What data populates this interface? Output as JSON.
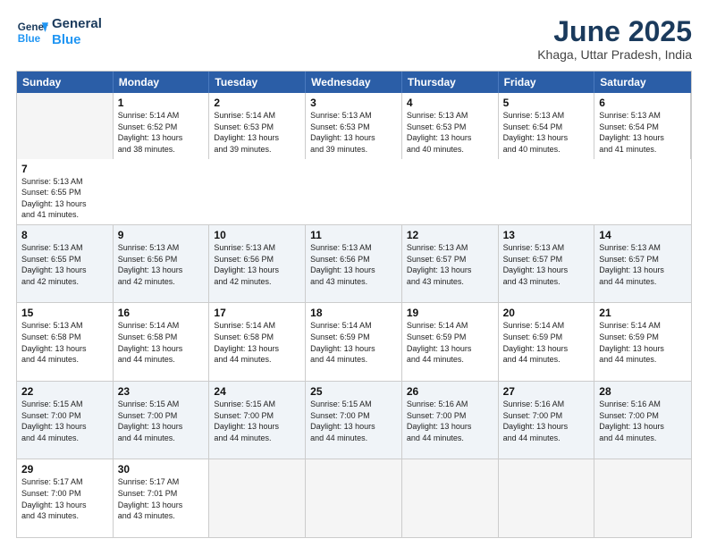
{
  "header": {
    "logo_line1": "General",
    "logo_line2": "Blue",
    "month": "June 2025",
    "location": "Khaga, Uttar Pradesh, India"
  },
  "days": [
    "Sunday",
    "Monday",
    "Tuesday",
    "Wednesday",
    "Thursday",
    "Friday",
    "Saturday"
  ],
  "rows": [
    [
      {
        "day": "",
        "empty": true
      },
      {
        "day": "1",
        "line1": "Sunrise: 5:14 AM",
        "line2": "Sunset: 6:52 PM",
        "line3": "Daylight: 13 hours",
        "line4": "and 38 minutes."
      },
      {
        "day": "2",
        "line1": "Sunrise: 5:14 AM",
        "line2": "Sunset: 6:53 PM",
        "line3": "Daylight: 13 hours",
        "line4": "and 39 minutes."
      },
      {
        "day": "3",
        "line1": "Sunrise: 5:13 AM",
        "line2": "Sunset: 6:53 PM",
        "line3": "Daylight: 13 hours",
        "line4": "and 39 minutes."
      },
      {
        "day": "4",
        "line1": "Sunrise: 5:13 AM",
        "line2": "Sunset: 6:53 PM",
        "line3": "Daylight: 13 hours",
        "line4": "and 40 minutes."
      },
      {
        "day": "5",
        "line1": "Sunrise: 5:13 AM",
        "line2": "Sunset: 6:54 PM",
        "line3": "Daylight: 13 hours",
        "line4": "and 40 minutes."
      },
      {
        "day": "6",
        "line1": "Sunrise: 5:13 AM",
        "line2": "Sunset: 6:54 PM",
        "line3": "Daylight: 13 hours",
        "line4": "and 41 minutes."
      },
      {
        "day": "7",
        "line1": "Sunrise: 5:13 AM",
        "line2": "Sunset: 6:55 PM",
        "line3": "Daylight: 13 hours",
        "line4": "and 41 minutes."
      }
    ],
    [
      {
        "day": "8",
        "line1": "Sunrise: 5:13 AM",
        "line2": "Sunset: 6:55 PM",
        "line3": "Daylight: 13 hours",
        "line4": "and 42 minutes."
      },
      {
        "day": "9",
        "line1": "Sunrise: 5:13 AM",
        "line2": "Sunset: 6:56 PM",
        "line3": "Daylight: 13 hours",
        "line4": "and 42 minutes."
      },
      {
        "day": "10",
        "line1": "Sunrise: 5:13 AM",
        "line2": "Sunset: 6:56 PM",
        "line3": "Daylight: 13 hours",
        "line4": "and 42 minutes."
      },
      {
        "day": "11",
        "line1": "Sunrise: 5:13 AM",
        "line2": "Sunset: 6:56 PM",
        "line3": "Daylight: 13 hours",
        "line4": "and 43 minutes."
      },
      {
        "day": "12",
        "line1": "Sunrise: 5:13 AM",
        "line2": "Sunset: 6:57 PM",
        "line3": "Daylight: 13 hours",
        "line4": "and 43 minutes."
      },
      {
        "day": "13",
        "line1": "Sunrise: 5:13 AM",
        "line2": "Sunset: 6:57 PM",
        "line3": "Daylight: 13 hours",
        "line4": "and 43 minutes."
      },
      {
        "day": "14",
        "line1": "Sunrise: 5:13 AM",
        "line2": "Sunset: 6:57 PM",
        "line3": "Daylight: 13 hours",
        "line4": "and 44 minutes."
      }
    ],
    [
      {
        "day": "15",
        "line1": "Sunrise: 5:13 AM",
        "line2": "Sunset: 6:58 PM",
        "line3": "Daylight: 13 hours",
        "line4": "and 44 minutes."
      },
      {
        "day": "16",
        "line1": "Sunrise: 5:14 AM",
        "line2": "Sunset: 6:58 PM",
        "line3": "Daylight: 13 hours",
        "line4": "and 44 minutes."
      },
      {
        "day": "17",
        "line1": "Sunrise: 5:14 AM",
        "line2": "Sunset: 6:58 PM",
        "line3": "Daylight: 13 hours",
        "line4": "and 44 minutes."
      },
      {
        "day": "18",
        "line1": "Sunrise: 5:14 AM",
        "line2": "Sunset: 6:59 PM",
        "line3": "Daylight: 13 hours",
        "line4": "and 44 minutes."
      },
      {
        "day": "19",
        "line1": "Sunrise: 5:14 AM",
        "line2": "Sunset: 6:59 PM",
        "line3": "Daylight: 13 hours",
        "line4": "and 44 minutes."
      },
      {
        "day": "20",
        "line1": "Sunrise: 5:14 AM",
        "line2": "Sunset: 6:59 PM",
        "line3": "Daylight: 13 hours",
        "line4": "and 44 minutes."
      },
      {
        "day": "21",
        "line1": "Sunrise: 5:14 AM",
        "line2": "Sunset: 6:59 PM",
        "line3": "Daylight: 13 hours",
        "line4": "and 44 minutes."
      }
    ],
    [
      {
        "day": "22",
        "line1": "Sunrise: 5:15 AM",
        "line2": "Sunset: 7:00 PM",
        "line3": "Daylight: 13 hours",
        "line4": "and 44 minutes."
      },
      {
        "day": "23",
        "line1": "Sunrise: 5:15 AM",
        "line2": "Sunset: 7:00 PM",
        "line3": "Daylight: 13 hours",
        "line4": "and 44 minutes."
      },
      {
        "day": "24",
        "line1": "Sunrise: 5:15 AM",
        "line2": "Sunset: 7:00 PM",
        "line3": "Daylight: 13 hours",
        "line4": "and 44 minutes."
      },
      {
        "day": "25",
        "line1": "Sunrise: 5:15 AM",
        "line2": "Sunset: 7:00 PM",
        "line3": "Daylight: 13 hours",
        "line4": "and 44 minutes."
      },
      {
        "day": "26",
        "line1": "Sunrise: 5:16 AM",
        "line2": "Sunset: 7:00 PM",
        "line3": "Daylight: 13 hours",
        "line4": "and 44 minutes."
      },
      {
        "day": "27",
        "line1": "Sunrise: 5:16 AM",
        "line2": "Sunset: 7:00 PM",
        "line3": "Daylight: 13 hours",
        "line4": "and 44 minutes."
      },
      {
        "day": "28",
        "line1": "Sunrise: 5:16 AM",
        "line2": "Sunset: 7:00 PM",
        "line3": "Daylight: 13 hours",
        "line4": "and 44 minutes."
      }
    ],
    [
      {
        "day": "29",
        "line1": "Sunrise: 5:17 AM",
        "line2": "Sunset: 7:00 PM",
        "line3": "Daylight: 13 hours",
        "line4": "and 43 minutes."
      },
      {
        "day": "30",
        "line1": "Sunrise: 5:17 AM",
        "line2": "Sunset: 7:01 PM",
        "line3": "Daylight: 13 hours",
        "line4": "and 43 minutes."
      },
      {
        "day": "",
        "empty": true
      },
      {
        "day": "",
        "empty": true
      },
      {
        "day": "",
        "empty": true
      },
      {
        "day": "",
        "empty": true
      },
      {
        "day": "",
        "empty": true
      }
    ]
  ]
}
